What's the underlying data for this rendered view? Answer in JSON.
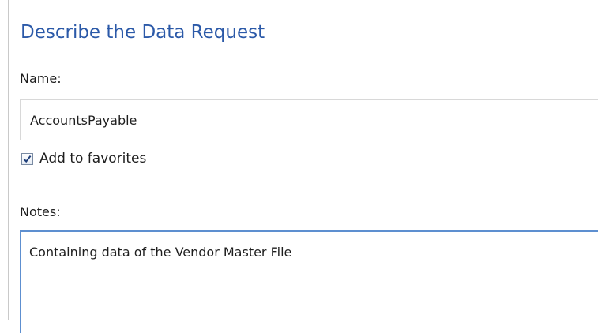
{
  "dialog": {
    "title": "Describe the Data Request",
    "name_label": "Name:",
    "name_value": "AccountsPayable",
    "favorites_label": "Add to favorites",
    "favorites_checked": true,
    "notes_label": "Notes:",
    "notes_value": "Containing data of the Vendor Master File"
  }
}
